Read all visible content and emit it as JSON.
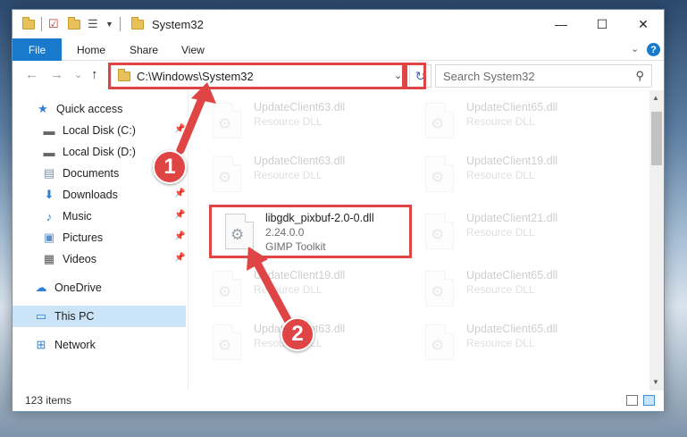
{
  "window": {
    "title": "System32",
    "controls": {
      "minimize": "—",
      "maximize": "☐",
      "close": "✕"
    }
  },
  "ribbon": {
    "tabs": [
      "File",
      "Home",
      "Share",
      "View"
    ],
    "help": "?"
  },
  "nav": {
    "back": "←",
    "forward": "→",
    "recent": "⌄",
    "up": "↑",
    "address": "C:\\Windows\\System32",
    "search_placeholder": "Search System32"
  },
  "sidebar": {
    "items": [
      {
        "label": "Quick access",
        "icon": "star-icon",
        "glyph": "★",
        "pinned": false
      },
      {
        "label": "Local Disk (C:)",
        "icon": "drive-icon",
        "glyph": "▬",
        "pinned": true
      },
      {
        "label": "Local Disk (D:)",
        "icon": "drive-icon",
        "glyph": "▬",
        "pinned": true
      },
      {
        "label": "Documents",
        "icon": "documents-icon",
        "glyph": "▤",
        "pinned": true
      },
      {
        "label": "Downloads",
        "icon": "download-icon",
        "glyph": "⬇",
        "pinned": true
      },
      {
        "label": "Music",
        "icon": "music-icon",
        "glyph": "♪",
        "pinned": true
      },
      {
        "label": "Pictures",
        "icon": "pictures-icon",
        "glyph": "▣",
        "pinned": true
      },
      {
        "label": "Videos",
        "icon": "videos-icon",
        "glyph": "▦",
        "pinned": true
      },
      {
        "label": "OneDrive",
        "icon": "cloud-icon",
        "glyph": "☁",
        "pinned": false
      },
      {
        "label": "This PC",
        "icon": "computer-icon",
        "glyph": "▭",
        "pinned": false
      },
      {
        "label": "Network",
        "icon": "network-icon",
        "glyph": "⊞",
        "pinned": false
      }
    ]
  },
  "files": [
    {
      "name": "UpdateClient63.dll",
      "line2": "Resource DLL",
      "line3": "",
      "highlight": false
    },
    {
      "name": "UpdateClient65.dll",
      "line2": "Resource DLL",
      "line3": "",
      "highlight": false
    },
    {
      "name": "UpdateClient63.dll",
      "line2": "Resource DLL",
      "line3": "",
      "highlight": false
    },
    {
      "name": "UpdateClient19.dll",
      "line2": "Resource DLL",
      "line3": "",
      "highlight": false
    },
    {
      "name": "libgdk_pixbuf-2.0-0.dll",
      "line2": "2.24.0.0",
      "line3": "GIMP Toolkit",
      "highlight": true
    },
    {
      "name": "UpdateClient21.dll",
      "line2": "Resource DLL",
      "line3": "",
      "highlight": false
    },
    {
      "name": "UpdateClient19.dll",
      "line2": "Resource DLL",
      "line3": "",
      "highlight": false
    },
    {
      "name": "UpdateClient65.dll",
      "line2": "Resource DLL",
      "line3": "",
      "highlight": false
    },
    {
      "name": "UpdateClient63.dll",
      "line2": "Resource DLL",
      "line3": "",
      "highlight": false
    },
    {
      "name": "UpdateClient65.dll",
      "line2": "Resource DLL",
      "line3": "",
      "highlight": false
    }
  ],
  "status": {
    "item_count": "123 items"
  },
  "callouts": [
    "1",
    "2"
  ],
  "colors": {
    "accent": "#1979ca",
    "highlight": "#e04545",
    "selected": "#cce4f7"
  }
}
